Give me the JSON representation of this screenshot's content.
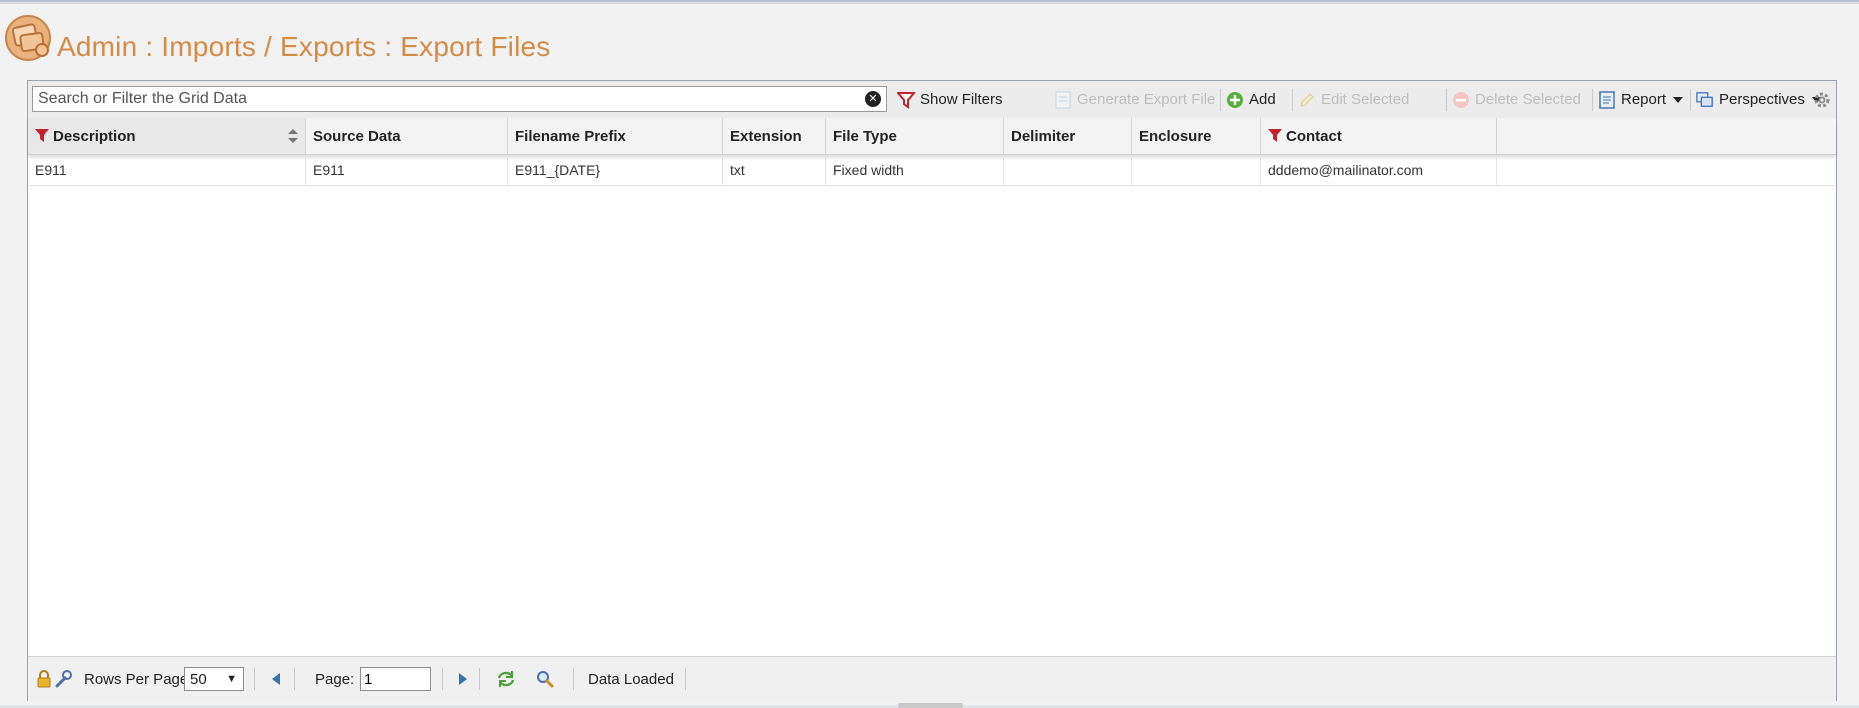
{
  "title": "Admin : Imports / Exports : Export Files",
  "search": {
    "placeholder": "Search or Filter the Grid Data",
    "value": ""
  },
  "toolbar": {
    "show_filters": "Show Filters",
    "generate_export": "Generate Export File",
    "add": "Add",
    "edit_selected": "Edit Selected",
    "delete_selected": "Delete Selected",
    "report": "Report",
    "perspectives": "Perspectives"
  },
  "columns": [
    "Description",
    "Source Data",
    "Filename Prefix",
    "Extension",
    "File Type",
    "Delimiter",
    "Enclosure",
    "Contact"
  ],
  "rows": [
    [
      "E911",
      "E911",
      "E911_{DATE}",
      "txt",
      "Fixed width",
      "",
      "",
      "dddemo@mailinator.com"
    ]
  ],
  "footer": {
    "rows_per_page_label": "Rows Per Page:",
    "rows_per_page": "50",
    "page_label": "Page:",
    "page": "1",
    "status": "Data Loaded"
  },
  "colors": {
    "title": "#d38b46",
    "filter_red": "#c0232b",
    "add_green": "#5cad3e",
    "icon_blue": "#3b6fb6"
  },
  "icons": [
    "app-logo-icon",
    "clear-search-icon",
    "filter-icon",
    "generate-export-icon",
    "add-icon",
    "edit-icon",
    "delete-icon",
    "report-icon",
    "perspectives-icon",
    "gear-icon",
    "sort-icon",
    "lock-icon",
    "wrench-icon",
    "prev-page-icon",
    "next-page-icon",
    "refresh-icon",
    "search-zoom-icon"
  ]
}
